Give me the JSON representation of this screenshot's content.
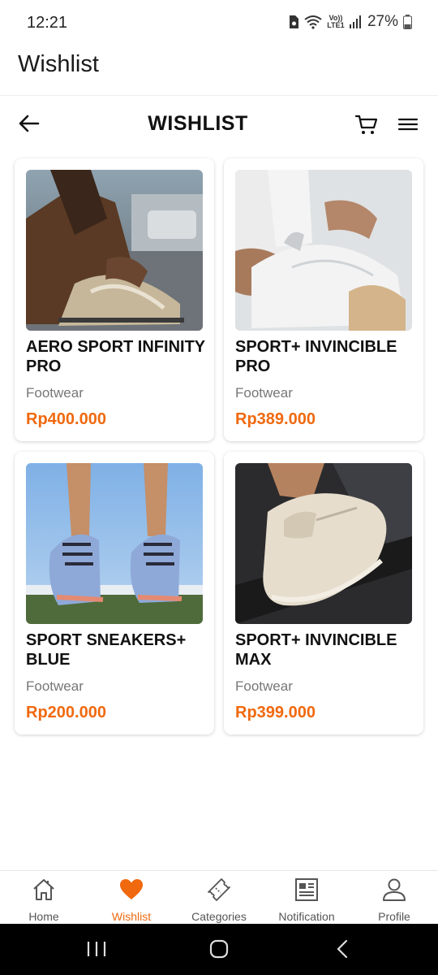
{
  "status_bar": {
    "time": "12:21",
    "battery": "27%",
    "network": "Vo)) LTE1"
  },
  "app_title": "Wishlist",
  "header": {
    "title": "WISHLIST",
    "back_icon": "arrow-left-icon",
    "cart_icon": "cart-icon",
    "menu_icon": "hamburger-menu-icon"
  },
  "products": [
    {
      "name": "AERO SPORT INFINITY PRO",
      "category": "Footwear",
      "price": "Rp400.000"
    },
    {
      "name": "SPORT+ INVINCIBLE PRO",
      "category": "Footwear",
      "price": "Rp389.000"
    },
    {
      "name": "SPORT SNEAKERS+ BLUE",
      "category": "Footwear",
      "price": "Rp200.000"
    },
    {
      "name": "SPORT+ INVINCIBLE MAX",
      "category": "Footwear",
      "price": "Rp399.000"
    }
  ],
  "bottom_nav": [
    {
      "label": "Home",
      "icon": "home-icon"
    },
    {
      "label": "Wishlist",
      "icon": "heart-icon",
      "active": true
    },
    {
      "label": "Categories",
      "icon": "ticket-icon"
    },
    {
      "label": "Notification",
      "icon": "newspaper-icon"
    },
    {
      "label": "Profile",
      "icon": "user-icon"
    }
  ],
  "colors": {
    "accent": "#f0690f",
    "text": "#111111",
    "muted": "#777777"
  }
}
